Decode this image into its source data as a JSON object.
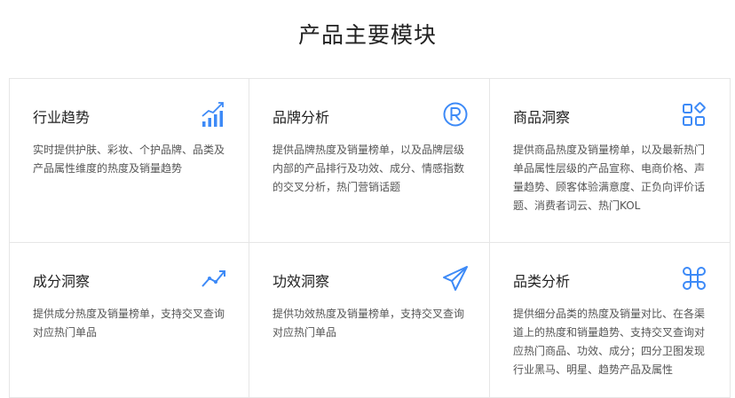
{
  "header": {
    "title": "产品主要模块"
  },
  "modules": [
    {
      "title": "行业趋势",
      "desc": "实时提供护肤、彩妆、个护品牌、品类及产品属性维度的热度及销量趋势",
      "icon": "bar-chart-trend-icon"
    },
    {
      "title": "品牌分析",
      "desc": "提供品牌热度及销量榜单，以及品牌层级内部的产品排行及功效、成分、情感指数的交叉分析，热门营销话题",
      "icon": "registered-trademark-icon"
    },
    {
      "title": "商品洞察",
      "desc": "提供商品热度及销量榜单，以及最新热门单品属性层级的产品宣称、电商价格、声量趋势、顾客体验满意度、正负向评价话题、消费者词云、热门KOL",
      "icon": "category-grid-icon"
    },
    {
      "title": "成分洞察",
      "desc": "提供成分热度及销量榜单，支持交叉查询对应热门单品",
      "icon": "line-chart-icon"
    },
    {
      "title": "功效洞察",
      "desc": "提供功效热度及销量榜单，支持交叉查询对应热门单品",
      "icon": "paper-plane-icon"
    },
    {
      "title": "品类分析",
      "desc": "提供细分品类的热度及销量对比、在各渠道上的热度和销量趋势、支持交叉查询对应热门商品、功效、成分；四分卫图发现行业黑马、明星、趋势产品及属性",
      "icon": "command-clover-icon"
    }
  ],
  "colors": {
    "accent": "#3d8af7",
    "title": "#222222",
    "text": "#555555",
    "border": "#e6e6e6"
  }
}
